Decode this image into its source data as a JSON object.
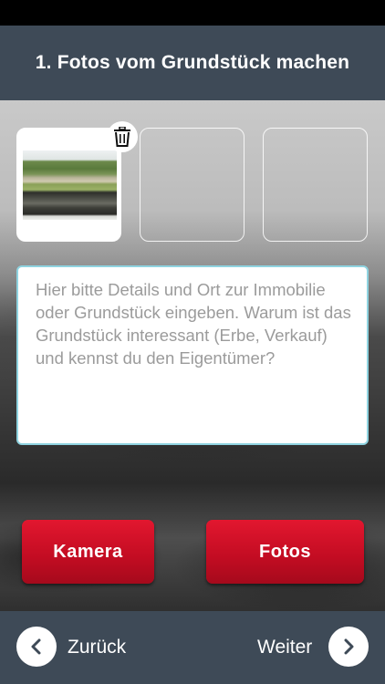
{
  "header": {
    "title": "1. Fotos vom Grundstück machen"
  },
  "photos": {
    "slots": [
      {
        "filled": true,
        "image": "property-photo-thumbnail",
        "delete_icon": "trash-icon"
      },
      {
        "filled": false
      },
      {
        "filled": false
      }
    ]
  },
  "details": {
    "value": "",
    "placeholder": "Hier bitte Details und Ort zur Immobilie oder Grundstück eingeben. Warum ist das Grundstück interessant (Erbe, Verkauf) und kennst du den Eigentümer?"
  },
  "actions": {
    "camera_label": "Kamera",
    "photos_label": "Fotos"
  },
  "footer": {
    "back_label": "Zurück",
    "back_icon": "chevron-left-icon",
    "next_label": "Weiter",
    "next_icon": "chevron-right-icon"
  },
  "colors": {
    "header_bg": "#3e4a57",
    "accent_red": "#d0112a",
    "field_border": "#8fd3e0"
  }
}
